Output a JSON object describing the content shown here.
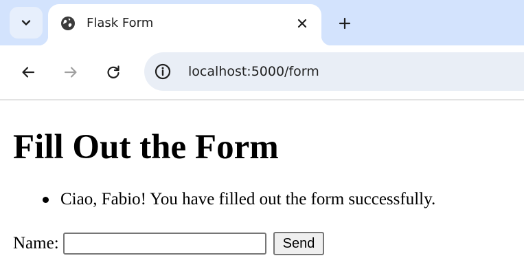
{
  "browser": {
    "tab": {
      "title": "Flask Form",
      "favicon": "globe-icon",
      "close_icon": "close-icon"
    },
    "tab_search_icon": "chevron-down-icon",
    "new_tab_icon": "plus-icon",
    "toolbar": {
      "back_icon": "arrow-left-icon",
      "forward_icon": "arrow-right-icon",
      "reload_icon": "reload-icon",
      "site_info_icon": "info-icon",
      "url": "localhost:5000/form"
    },
    "colors": {
      "tabstrip": "#d3e3fd",
      "omnibox": "#e9eef6"
    }
  },
  "page": {
    "heading": "Fill Out the Form",
    "messages": [
      "Ciao, Fabio! You have filled out the form successfully."
    ],
    "form": {
      "name_label": "Name:",
      "name_value": "",
      "submit_label": "Send"
    }
  }
}
